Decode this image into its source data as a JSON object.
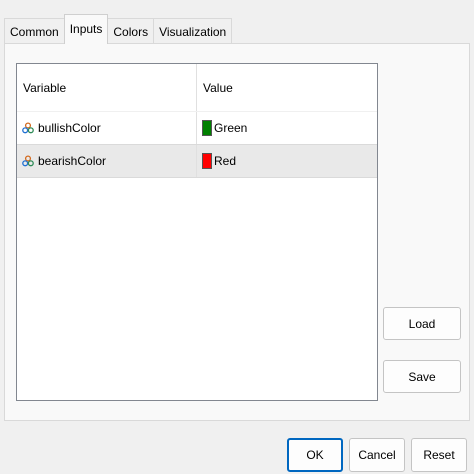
{
  "tabs": [
    {
      "label": "Common"
    },
    {
      "label": "Inputs",
      "active": true
    },
    {
      "label": "Colors"
    },
    {
      "label": "Visualization"
    }
  ],
  "table": {
    "headers": {
      "variable": "Variable",
      "value": "Value"
    },
    "rows": [
      {
        "icon": "variable-icon",
        "variable": "bullishColor",
        "value": "Green",
        "swatch_color": "#008000"
      },
      {
        "icon": "variable-icon",
        "variable": "bearishColor",
        "value": "Red",
        "swatch_color": "#ff0000",
        "selected": true
      }
    ]
  },
  "side_buttons": {
    "load": "Load",
    "save": "Save"
  },
  "dialog_buttons": {
    "ok": "OK",
    "cancel": "Cancel",
    "reset": "Reset"
  }
}
